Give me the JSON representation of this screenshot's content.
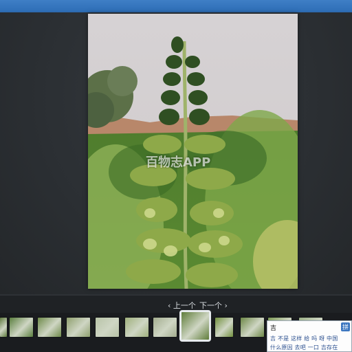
{
  "viewer": {
    "watermark_text": "百物志APP",
    "photo_subject": "plant-photo",
    "nav": {
      "prev_label": "‹ 上一个",
      "next_label": "下一个 ›"
    },
    "selected_thumbnail_index": 6
  },
  "thumbnails": [
    {
      "name": "thumb-1",
      "color": "#5f7a3e"
    },
    {
      "name": "thumb-2",
      "color": "#5b7f3f"
    },
    {
      "name": "thumb-3",
      "color": "#6e8a4a"
    },
    {
      "name": "thumb-4",
      "color": "#8fa06e"
    },
    {
      "name": "thumb-5",
      "color": "#b8c4a8"
    },
    {
      "name": "thumb-6",
      "color": "#9fb07d"
    },
    {
      "name": "thumb-7",
      "color": "#a3ad8f"
    },
    {
      "name": "thumb-8",
      "color": "#5f7d3a"
    },
    {
      "name": "thumb-9",
      "color": "#72903f"
    },
    {
      "name": "thumb-10",
      "color": "#6d8847"
    },
    {
      "name": "thumb-11",
      "color": "#7d9a55"
    },
    {
      "name": "thumb-12",
      "color": "#9aaf86"
    }
  ],
  "ime": {
    "input_text": "吉",
    "badge_label": "拼",
    "candidates_row1": "吉 不是 这样 给 吗 呀 中国",
    "candidates_row2": "什么原因 去吧 一口 吉存在"
  },
  "colors": {
    "titlebar": "#2f6fb7",
    "viewer_bg": "#2b2f33",
    "thumb_strip_bg": "#1a1c1f",
    "selected_outline": "#e8ecef"
  }
}
